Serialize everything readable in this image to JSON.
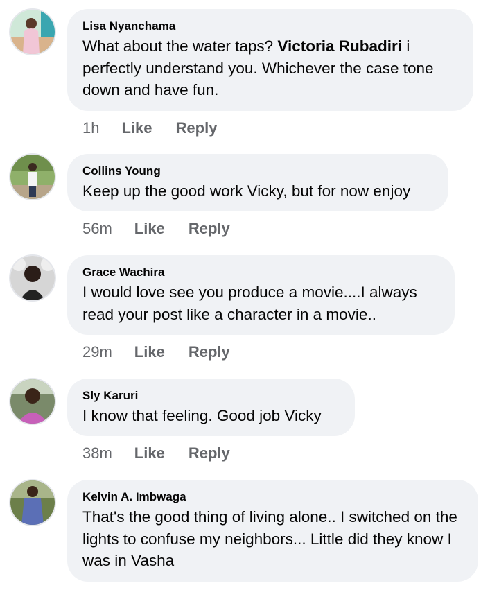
{
  "comments": [
    {
      "author": "Lisa Nyanchama",
      "text_before": "What about the water taps? ",
      "mention": "Victoria Rubadiri",
      "text_after": " i perfectly understand you. Whichever the case tone down and have fun.",
      "time": "1h",
      "like": "Like",
      "reply": "Reply"
    },
    {
      "author": "Collins Young",
      "text": "Keep up the good work Vicky, but for now enjoy",
      "time": "56m",
      "like": "Like",
      "reply": "Reply"
    },
    {
      "author": "Grace Wachira",
      "text": "I would love see you produce a movie....I always read your post like a character in a movie..",
      "time": "29m",
      "like": "Like",
      "reply": "Reply"
    },
    {
      "author": "Sly Karuri",
      "text": "I know that feeling. Good job Vicky",
      "time": "38m",
      "like": "Like",
      "reply": "Reply"
    },
    {
      "author": "Kelvin A. Imbwaga",
      "text": "That's the good thing of  living alone.. I switched on the lights  to confuse my neighbors... Little did they know I was in Vasha",
      "time": "",
      "like": "",
      "reply": ""
    }
  ],
  "colors": {
    "bubble": "#f0f2f5",
    "meta": "#65676b",
    "text": "#050505"
  }
}
